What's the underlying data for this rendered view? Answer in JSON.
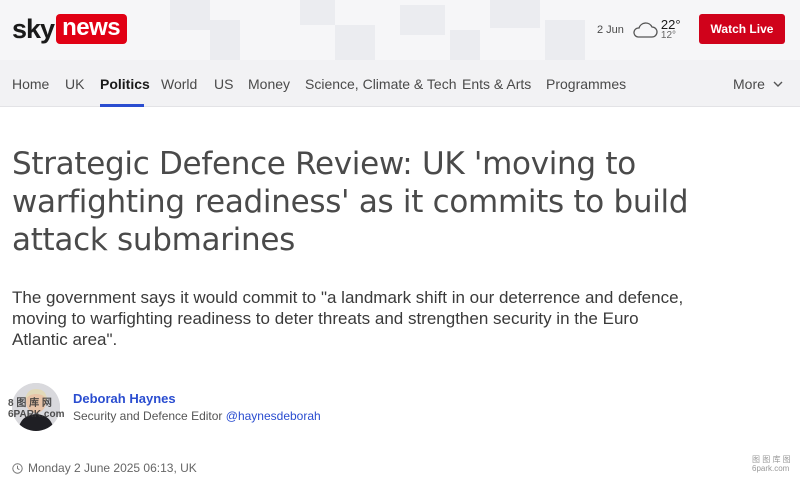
{
  "header": {
    "logo_sky": "sky",
    "logo_news": "news",
    "weather": {
      "date": "2 Jun",
      "high": "22°",
      "low": "12°",
      "icon": "cloud-icon"
    },
    "watch_live_label": "Watch Live"
  },
  "nav": {
    "items": [
      {
        "label": "Home"
      },
      {
        "label": "UK"
      },
      {
        "label": "Politics",
        "active": true
      },
      {
        "label": "World"
      },
      {
        "label": "US"
      },
      {
        "label": "Money"
      },
      {
        "label": "Science, Climate & Tech"
      },
      {
        "label": "Ents & Arts"
      },
      {
        "label": "Programmes"
      }
    ],
    "more_label": "More"
  },
  "article": {
    "headline": "Strategic Defence Review: UK 'moving to warfighting readiness' as it commits to build attack submarines",
    "standfirst": "The government says it would commit to \"a landmark shift in our deterrence and defence, moving to warfighting readiness to deter threats and strengthen security in the Euro Atlantic area\".",
    "author": {
      "name": "Deborah Haynes",
      "role": "Security and Defence Editor",
      "handle": "@haynesdeborah"
    },
    "timestamp": "Monday 2 June 2025 06:13, UK"
  },
  "overlay": {
    "watermark_line1": "8 图 库 网",
    "watermark_line2": "6PARK.com",
    "corner_line1": "图 图 库 图",
    "corner_line2": "6park.com"
  },
  "colors": {
    "brand_red": "#e10014",
    "watch_live_red": "#d0021b",
    "link_blue": "#2a4dd0"
  }
}
